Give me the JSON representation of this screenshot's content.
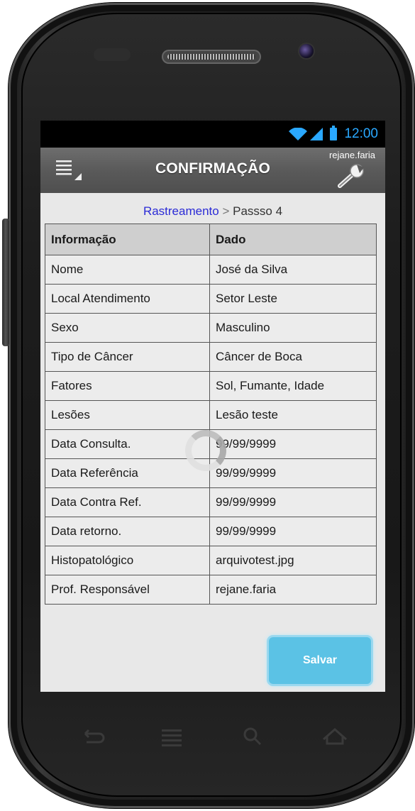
{
  "status": {
    "time": "12:00"
  },
  "appbar": {
    "title": "CONFIRMAÇÃO",
    "user": "rejane.faria"
  },
  "breadcrumb": {
    "link": "Rastreamento",
    "separator": ">",
    "step": "Passso 4"
  },
  "table": {
    "headers": [
      "Informação",
      "Dado"
    ],
    "rows": [
      [
        "Nome",
        "José da Silva"
      ],
      [
        "Local Atendimento",
        "Setor Leste"
      ],
      [
        "Sexo",
        "Masculino"
      ],
      [
        "Tipo de Câncer",
        "Câncer de Boca"
      ],
      [
        "Fatores",
        "Sol, Fumante, Idade"
      ],
      [
        "Lesões",
        "Lesão teste"
      ],
      [
        "Data Consulta.",
        "99/99/9999"
      ],
      [
        "Data Referência",
        "99/99/9999"
      ],
      [
        "Data Contra Ref.",
        "99/99/9999"
      ],
      [
        "Data retorno.",
        "99/99/9999"
      ],
      [
        "Histopatológico",
        "arquivotest.jpg"
      ],
      [
        "Prof. Responsável",
        "rejane.faria"
      ]
    ]
  },
  "actions": {
    "save_label": "Salvar"
  },
  "colors": {
    "accent": "#2aa8ff",
    "button": "#5bc2e5",
    "link": "#2b2bd6"
  },
  "icons": [
    "wifi-icon",
    "signal-icon",
    "battery-icon",
    "menu-icon",
    "wrench-icon",
    "back-icon",
    "recent-apps-icon",
    "search-icon",
    "home-icon"
  ]
}
